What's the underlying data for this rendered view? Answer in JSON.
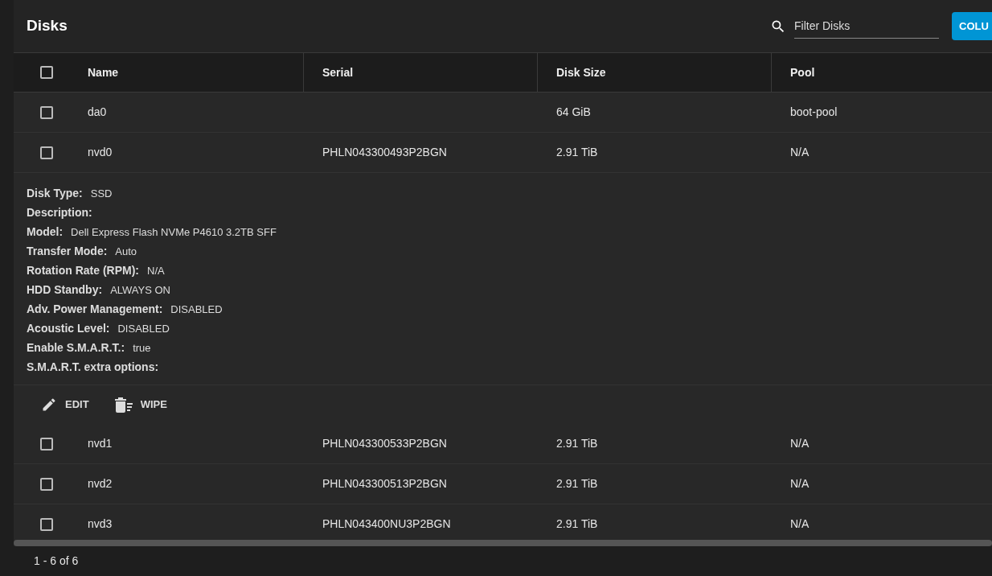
{
  "header": {
    "title": "Disks",
    "filter": {
      "placeholder": "Filter Disks"
    },
    "columns_button": "COLU"
  },
  "table": {
    "select_all": {
      "checked": false
    },
    "columns": [
      "Name",
      "Serial",
      "Disk Size",
      "Pool"
    ],
    "rows": [
      {
        "name": "da0",
        "disk_size": "64 GiB",
        "pool": "boot-pool",
        "checked": false
      },
      {
        "name": "nvd0",
        "serial": "PHLN043300493P2BGN",
        "disk_size": "2.91 TiB",
        "pool": "N/A",
        "checked": false,
        "details": [
          {
            "label": "Disk Type:",
            "value": "SSD"
          },
          {
            "label": "Description:"
          },
          {
            "label": "Model:",
            "value": "Dell Express Flash NVMe P4610 3.2TB SFF"
          },
          {
            "label": "Transfer Mode:",
            "value": "Auto"
          },
          {
            "label": "Rotation Rate (RPM):",
            "value": "N/A"
          },
          {
            "label": "HDD Standby:",
            "value": "ALWAYS ON"
          },
          {
            "label": "Adv. Power Management:",
            "value": "DISABLED"
          },
          {
            "label": "Acoustic Level:",
            "value": "DISABLED"
          },
          {
            "label": "Enable S.M.A.R.T.:",
            "value": "true"
          },
          {
            "label": "S.M.A.R.T. extra options:"
          }
        ],
        "actions": [
          {
            "kind": "edit",
            "label": "EDIT"
          },
          {
            "kind": "wipe",
            "label": "WIPE"
          }
        ]
      },
      {
        "name": "nvd1",
        "serial": "PHLN043300533P2BGN",
        "disk_size": "2.91 TiB",
        "pool": "N/A",
        "checked": false
      },
      {
        "name": "nvd2",
        "serial": "PHLN043300513P2BGN",
        "disk_size": "2.91 TiB",
        "pool": "N/A",
        "checked": false
      },
      {
        "name": "nvd3",
        "serial": "PHLN043400NU3P2BGN",
        "disk_size": "2.91 TiB",
        "pool": "N/A",
        "checked": false
      }
    ]
  },
  "paginator": "1 - 6 of 6"
}
